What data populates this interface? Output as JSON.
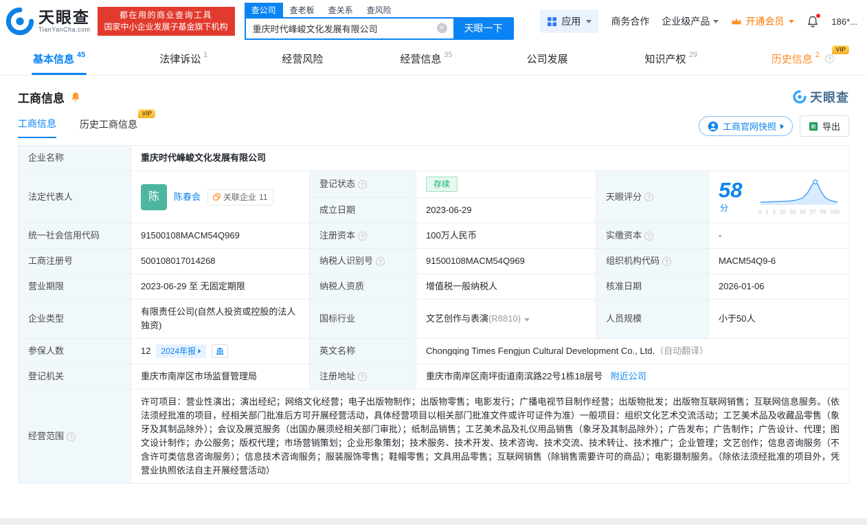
{
  "brand": {
    "name": "天眼查",
    "domain": "TianYanCha.com"
  },
  "promo": {
    "line1": "都在用的商业查询工具",
    "line2": "国家中小企业发展子基金旗下机构"
  },
  "search": {
    "tabs": [
      "查公司",
      "查老板",
      "查关系",
      "查风险"
    ],
    "value": "重庆时代峰峻文化发展有限公司",
    "button": "天眼一下"
  },
  "topnav": {
    "apps": "应用",
    "cooperation": "商务合作",
    "enterprise": "企业级产品",
    "vip": "开通会员",
    "phone": "186*..."
  },
  "page_tabs": [
    {
      "label": "基本信息",
      "count": "45"
    },
    {
      "label": "法律诉讼",
      "count": "1"
    },
    {
      "label": "经营风险",
      "count": ""
    },
    {
      "label": "经营信息",
      "count": "35"
    },
    {
      "label": "公司发展",
      "count": ""
    },
    {
      "label": "知识产权",
      "count": "29"
    },
    {
      "label": "历史信息",
      "count": "2"
    }
  ],
  "misc": {
    "vip": "VIP"
  },
  "section": {
    "title": "工商信息",
    "watermark": "天眼查",
    "subtab_current": "工商信息",
    "subtab_history": "历史工商信息",
    "snapshot": "工商官网快照",
    "export": "导出"
  },
  "fields": {
    "company_name": {
      "label": "企业名称",
      "value": "重庆时代峰峻文化发展有限公司"
    },
    "legal_rep": {
      "label": "法定代表人",
      "avatar": "陈",
      "name": "陈春会",
      "related": "关联企业",
      "related_count": "11"
    },
    "reg_status": {
      "label": "登记状态",
      "value": "存续"
    },
    "establish_date": {
      "label": "成立日期",
      "value": "2023-06-29"
    },
    "score": {
      "label": "天眼评分",
      "value": "58",
      "unit": "分",
      "axis": [
        "0",
        "1",
        "3",
        "15",
        "55",
        "65",
        "97",
        "99",
        "100"
      ]
    },
    "credit_code": {
      "label": "统一社会信用代码",
      "value": "91500108MACM54Q969"
    },
    "reg_capital": {
      "label": "注册资本",
      "value": "100万人民币"
    },
    "paid_capital": {
      "label": "实缴资本",
      "value": "-"
    },
    "reg_number": {
      "label": "工商注册号",
      "value": "500108017014268"
    },
    "taxpayer_id": {
      "label": "纳税人识别号",
      "value": "91500108MACM54Q969"
    },
    "org_code": {
      "label": "组织机构代码",
      "value": "MACM54Q9-6"
    },
    "business_term": {
      "label": "营业期限",
      "value": "2023-06-29 至 无固定期限"
    },
    "taxpayer_quality": {
      "label": "纳税人资质",
      "value": "增值税一般纳税人"
    },
    "approval_date": {
      "label": "核准日期",
      "value": "2026-01-06"
    },
    "company_type": {
      "label": "企业类型",
      "value": "有限责任公司(自然人投资或控股的法人独资)"
    },
    "industry": {
      "label": "国标行业",
      "value": "文艺创作与表演",
      "code": "(R8810)"
    },
    "staff_size": {
      "label": "人员规模",
      "value": "小于50人"
    },
    "insured": {
      "label": "参保人数",
      "value": "12",
      "report_badge": "2024年报"
    },
    "english_name": {
      "label": "英文名称",
      "value": "Chongqing Times Fengjun Cultural Development Co., Ltd.",
      "note": "（自动翻译）"
    },
    "reg_authority": {
      "label": "登记机关",
      "value": "重庆市南岸区市场监督管理局"
    },
    "reg_address": {
      "label": "注册地址",
      "value": "重庆市南岸区南坪街道南滨路22号1栋18层号",
      "nearby": "附近公司"
    },
    "business_scope": {
      "label": "经营范围",
      "value": "许可项目：营业性演出；演出经纪；网络文化经营；电子出版物制作；出版物零售；电影发行；广播电视节目制作经营；出版物批发；出版物互联网销售；互联网信息服务。（依法须经批准的项目，经相关部门批准后方可开展经营活动，具体经营项目以相关部门批准文件或许可证件为准）一般项目：组织文化艺术交流活动；工艺美术品及收藏品零售（象牙及其制品除外）；会议及展览服务（出国办展须经相关部门审批）；纸制品销售；工艺美术品及礼仪用品销售（象牙及其制品除外）；广告发布；广告制作；广告设计、代理；图文设计制作；办公服务；版权代理；市场营销策划；企业形象策划；技术服务、技术开发、技术咨询、技术交流、技术转让、技术推广；企业管理；文艺创作；信息咨询服务（不含许可类信息咨询服务）；信息技术咨询服务；服装服饰零售；鞋帽零售；文具用品零售；互联网销售（除销售需要许可的商品）；电影摄制服务。（除依法须经批准的项目外，凭营业执照依法自主开展经营活动）"
    }
  }
}
